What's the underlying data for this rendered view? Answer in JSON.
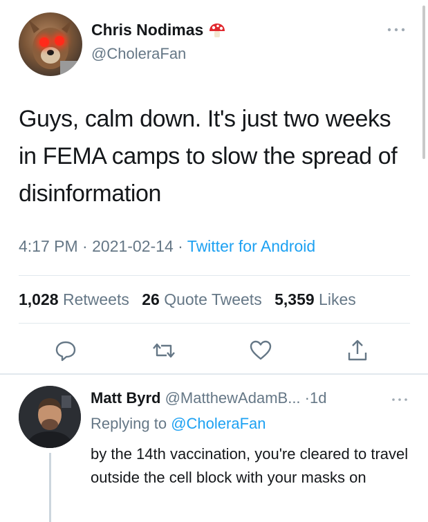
{
  "tweet": {
    "author_name": "Chris Nodimas",
    "author_handle": "@CholeraFan",
    "text": "Guys, calm down. It's just two weeks in FEMA camps to slow the spread of disinformation",
    "time": "4:17 PM",
    "date": "2021-02-14",
    "source": "Twitter for Android",
    "separator": " · "
  },
  "stats": {
    "retweets_count": "1,028",
    "retweets_label": "Retweets",
    "quote_count": "26",
    "quote_label": "Quote Tweets",
    "likes_count": "5,359",
    "likes_label": "Likes"
  },
  "actions": {
    "icons": [
      "reply-icon",
      "retweet-icon",
      "like-icon",
      "share-icon"
    ]
  },
  "reply": {
    "author_name": "Matt Byrd",
    "author_handle": "@MatthewAdamB...",
    "time": "·1d",
    "replying_prefix": "Replying to",
    "replying_to": "@CholeraFan",
    "text": "by the 14th vaccination, you're cleared to travel outside the cell block with your masks on"
  },
  "colors": {
    "link": "#1da1f2",
    "secondary_text": "#657786",
    "primary_text": "#14171a",
    "divider": "#e1e8ed"
  }
}
